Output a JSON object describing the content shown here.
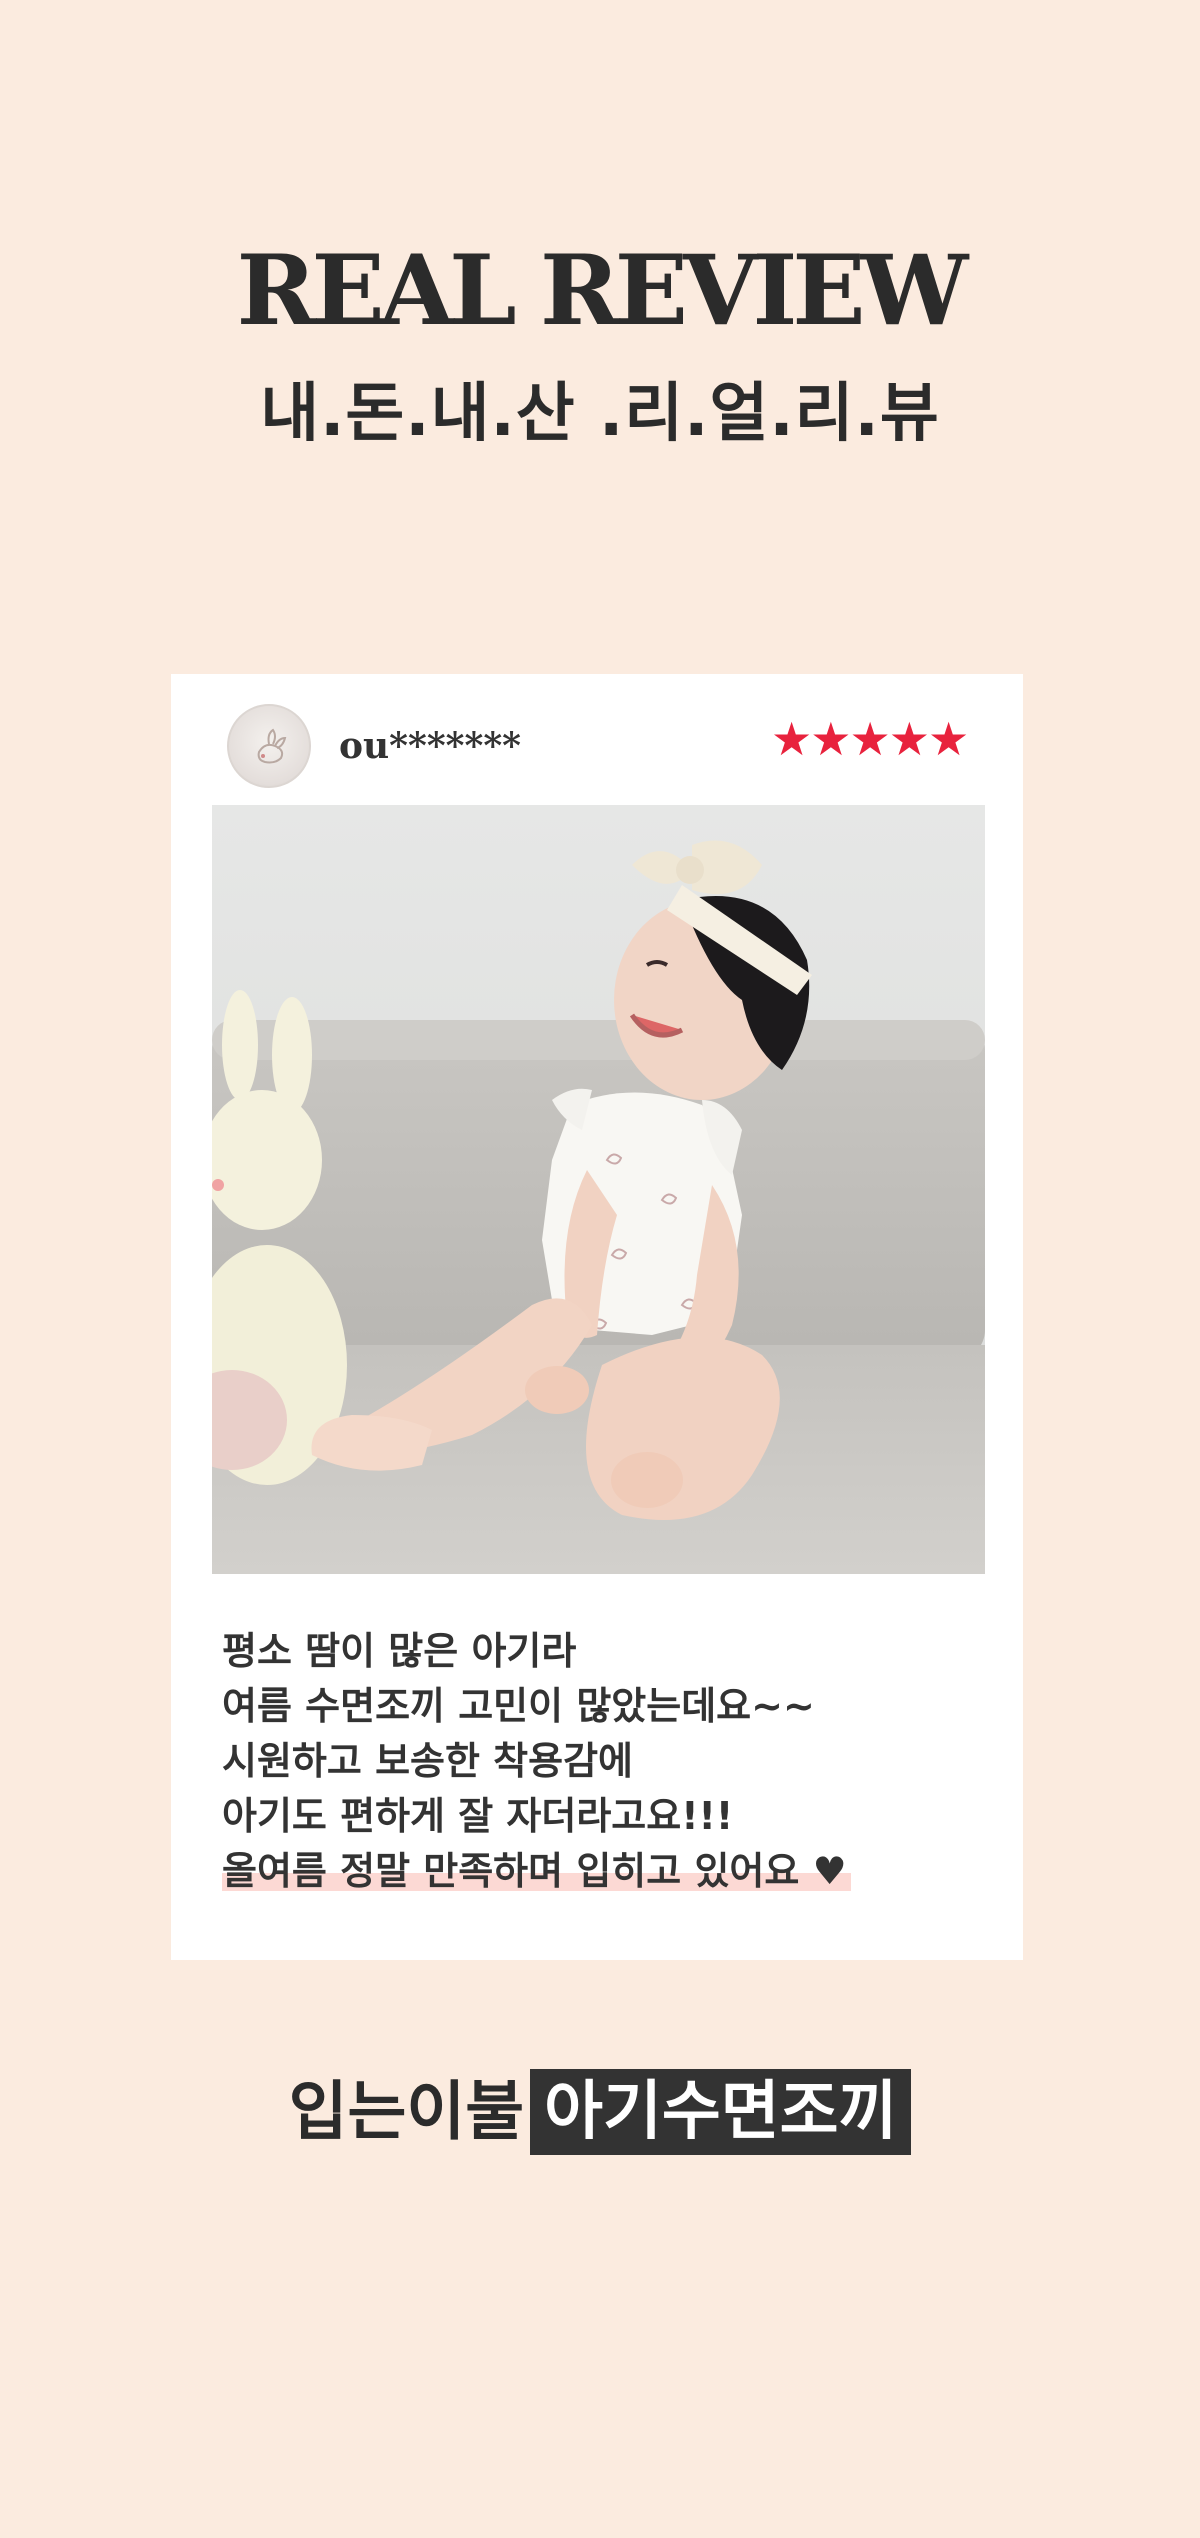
{
  "header": {
    "title": "REAL REVIEW",
    "subtitle": "내.돈.내.산 .리.얼.리.뷰"
  },
  "review": {
    "username": "ou*******",
    "stars": "★★★★★",
    "rating": 5,
    "avatar_icon": "bunny-avatar-icon",
    "photo_subject": "baby-photo",
    "lines": [
      "평소 땀이 많은 아기라",
      "여름 수면조끼 고민이 많았는데요~~",
      "시원하고 보송한 착용감에",
      "아기도 편하게 잘 자더라고요!!!",
      "올여름 정말 만족하며 입히고 있어요"
    ],
    "heart": "♥"
  },
  "footer": {
    "plain": "입는이불",
    "boxed": "아기수면조끼"
  },
  "colors": {
    "background": "#fbebdf",
    "star": "#e8223d",
    "highlight": "#fcd9d4",
    "dark": "#333333"
  }
}
